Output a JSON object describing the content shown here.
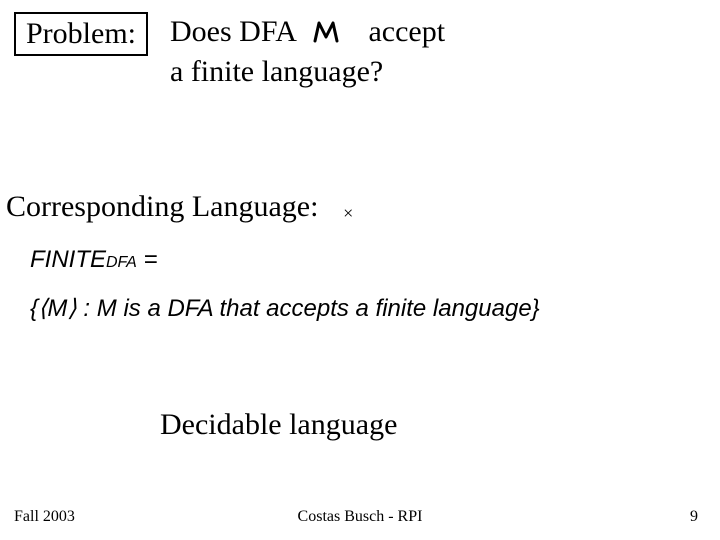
{
  "problem": {
    "label": "Problem:",
    "line1a": "Does DFA",
    "line1b": "accept",
    "line2": "a finite language?"
  },
  "corresponding": {
    "heading": "Corresponding Language:",
    "cross": "×"
  },
  "definition": {
    "lhs_main": "FINITE",
    "lhs_sub": "DFA",
    "equals": "=",
    "set_open": "{⟨",
    "M": "M",
    "set_mid": "⟩ : ",
    "set_rest": "is a DFA that accepts a finite language}"
  },
  "decidable": "Decidable language",
  "footer": {
    "left": "Fall 2003",
    "center": "Costas Busch - RPI",
    "right": "9"
  }
}
